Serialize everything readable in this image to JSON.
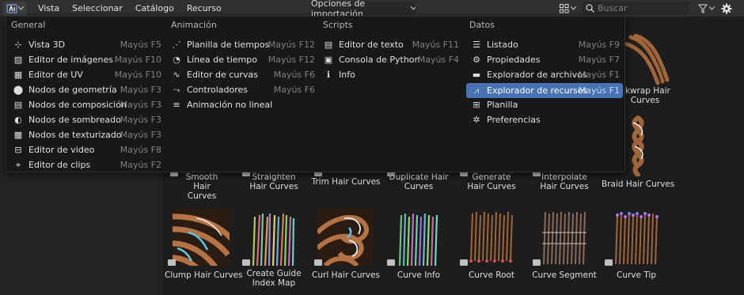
{
  "header": {
    "menus": [
      "Vista",
      "Seleccionar",
      "Catálogo",
      "Recurso"
    ],
    "import_options": "Opciones de importación",
    "search_placeholder": "Buscar"
  },
  "popup": {
    "columns": [
      {
        "title": "General",
        "items": [
          {
            "label": "Vista 3D",
            "shortcut": "Mayús F5",
            "icon": "3d-view-icon"
          },
          {
            "label": "Editor de imágenes",
            "shortcut": "Mayús F10",
            "icon": "image-editor-icon"
          },
          {
            "label": "Editor de UV",
            "shortcut": "Mayús F10",
            "icon": "uv-editor-icon"
          },
          {
            "label": "Nodos de geometría",
            "shortcut": "Mayús F3",
            "icon": "geometry-nodes-icon"
          },
          {
            "label": "Nodos de composición",
            "shortcut": "Mayús F3",
            "icon": "compositor-nodes-icon"
          },
          {
            "label": "Nodos de sombreado",
            "shortcut": "Mayús F3",
            "icon": "shader-nodes-icon"
          },
          {
            "label": "Nodos de texturizado",
            "shortcut": "Mayús F3",
            "icon": "texture-nodes-icon"
          },
          {
            "label": "Editor de video",
            "shortcut": "Mayús F8",
            "icon": "video-editor-icon"
          },
          {
            "label": "Editor de clips",
            "shortcut": "Mayús F2",
            "icon": "clip-editor-icon"
          }
        ]
      },
      {
        "title": "Animación",
        "items": [
          {
            "label": "Planilla de tiempos",
            "shortcut": "Mayús F12",
            "icon": "dopesheet-icon"
          },
          {
            "label": "Línea de tiempo",
            "shortcut": "Mayús F12",
            "icon": "timeline-icon"
          },
          {
            "label": "Editor de curvas",
            "shortcut": "Mayús F6",
            "icon": "graph-editor-icon"
          },
          {
            "label": "Controladores",
            "shortcut": "Mayús F6",
            "icon": "drivers-icon"
          },
          {
            "label": "Animación no lineal",
            "shortcut": "",
            "icon": "nla-icon"
          }
        ]
      },
      {
        "title": "Scripts",
        "items": [
          {
            "label": "Editor de texto",
            "shortcut": "Mayús F11",
            "icon": "text-editor-icon"
          },
          {
            "label": "Consola de Python",
            "shortcut": "Mayús F4",
            "icon": "python-console-icon"
          },
          {
            "label": "Info",
            "shortcut": "",
            "icon": "info-icon"
          }
        ]
      },
      {
        "title": "Datos",
        "items": [
          {
            "label": "Listado",
            "shortcut": "Mayús F9",
            "icon": "outliner-icon"
          },
          {
            "label": "Propiedades",
            "shortcut": "Mayús F7",
            "icon": "properties-icon"
          },
          {
            "label": "Explorador de archivos",
            "shortcut": "Mayús F1",
            "icon": "file-browser-icon"
          },
          {
            "label": "Explorador de recursos",
            "shortcut": "Mayús F1",
            "icon": "asset-browser-icon"
          },
          {
            "label": "Planilla",
            "shortcut": "",
            "icon": "spreadsheet-icon"
          },
          {
            "label": "Preferencias",
            "shortcut": "",
            "icon": "preferences-icon"
          }
        ]
      }
    ]
  },
  "assets": {
    "row1": [
      "Smooth Hair Curves",
      "Straighten Hair Curves",
      "Trim Hair Curves",
      "Duplicate Hair Curves",
      "Generate Hair Curves",
      "Interpolate Hair Curves",
      "Braid Hair Curves"
    ],
    "row2": [
      "Clump Hair Curves",
      "Create Guide Index Map",
      "Curl Hair Curves",
      "Curve Info",
      "Curve Root",
      "Curve Segment",
      "Curve Tip"
    ],
    "partial": "...nkwrap Hair Curves",
    "partial_visible": "nkwrap Hair\nCurves"
  },
  "colors": {
    "accent": "#4772b3",
    "hair": "#a0653a"
  }
}
